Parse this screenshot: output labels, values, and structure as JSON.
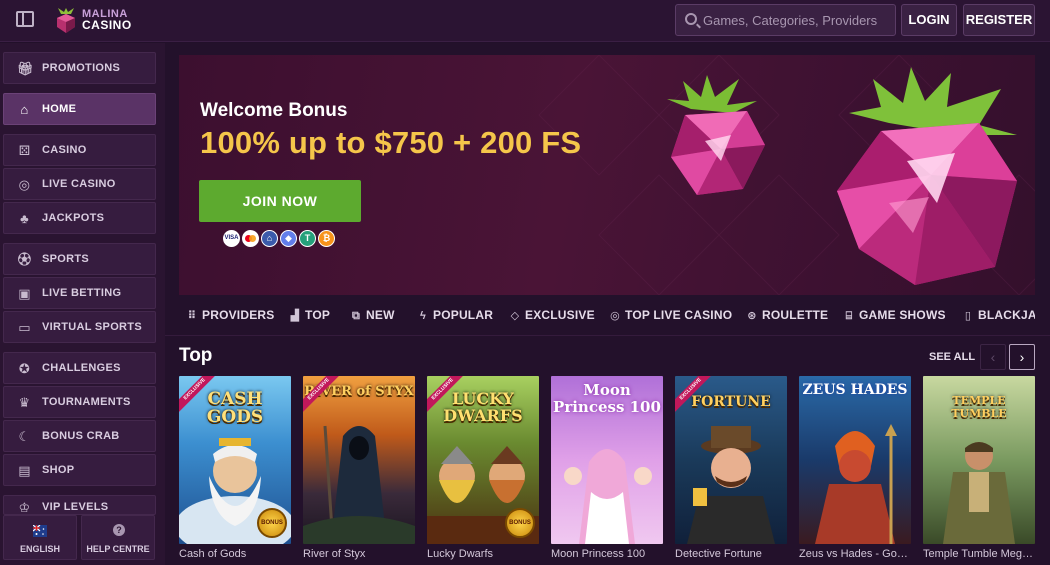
{
  "header": {
    "logo_line1": "MALINA",
    "logo_line2": "CASINO",
    "search_placeholder": "Games, Categories, Providers",
    "login_label": "LOGIN",
    "register_label": "REGISTER"
  },
  "sidebar": {
    "items": [
      {
        "label": "PROMOTIONS",
        "icon": "gift-icon"
      },
      {
        "label": "HOME",
        "icon": "home-icon"
      },
      {
        "label": "CASINO",
        "icon": "dice-icon"
      },
      {
        "label": "LIVE CASINO",
        "icon": "chip-icon"
      },
      {
        "label": "JACKPOTS",
        "icon": "money-bag-icon"
      },
      {
        "label": "SPORTS",
        "icon": "football-icon"
      },
      {
        "label": "LIVE BETTING",
        "icon": "live-icon"
      },
      {
        "label": "VIRTUAL SPORTS",
        "icon": "monitor-icon"
      },
      {
        "label": "CHALLENGES",
        "icon": "medal-icon"
      },
      {
        "label": "TOURNAMENTS",
        "icon": "trophy-icon"
      },
      {
        "label": "BONUS CRAB",
        "icon": "crab-claw-icon"
      },
      {
        "label": "SHOP",
        "icon": "shop-icon"
      },
      {
        "label": "VIP LEVELS",
        "icon": "crown-icon"
      }
    ],
    "language_label": "ENGLISH",
    "help_label": "HELP CENTRE"
  },
  "banner": {
    "subtitle": "Welcome Bonus",
    "title": "100% up to $750 + 200 FS",
    "cta_label": "JOIN NOW",
    "payments": [
      "VISA",
      "MC",
      "BANK",
      "ETH",
      "USDT",
      "BTC"
    ]
  },
  "categories": [
    {
      "label": "PROVIDERS",
      "icon": "grid-icon"
    },
    {
      "label": "TOP",
      "icon": "podium-icon"
    },
    {
      "label": "NEW",
      "icon": "new-icon"
    },
    {
      "label": "POPULAR",
      "icon": "lightning-icon"
    },
    {
      "label": "EXCLUSIVE",
      "icon": "diamond-icon"
    },
    {
      "label": "TOP LIVE CASINO",
      "icon": "chip-icon"
    },
    {
      "label": "ROULETTE",
      "icon": "roulette-icon"
    },
    {
      "label": "GAME SHOWS",
      "icon": "tv-icon"
    },
    {
      "label": "BLACKJACK",
      "icon": "cards-icon"
    }
  ],
  "top_section": {
    "title": "Top",
    "see_all_label": "SEE ALL",
    "games": [
      {
        "name": "Cash of Gods",
        "logo": "CASH GODS",
        "exclusive": true,
        "bonus": true
      },
      {
        "name": "River of Styx",
        "logo": "RIVER of STYX",
        "exclusive": true,
        "bonus": false
      },
      {
        "name": "Lucky Dwarfs",
        "logo": "LUCKY DWARFS",
        "exclusive": true,
        "bonus": true
      },
      {
        "name": "Moon Princess 100",
        "logo": "Moon Princess 100",
        "exclusive": false,
        "bonus": false
      },
      {
        "name": "Detective Fortune",
        "logo": "FORTUNE",
        "exclusive": true,
        "bonus": false
      },
      {
        "name": "Zeus vs Hades - Gods of War",
        "logo": "ZEUS HADES",
        "exclusive": false,
        "bonus": false
      },
      {
        "name": "Temple Tumble Megaways",
        "logo": "TEMPLE TUMBLE",
        "exclusive": false,
        "bonus": false
      }
    ],
    "exclusive_badge": "EXCLUSIVE",
    "bonus_badge": "BONUS"
  },
  "colors": {
    "background": "#22102a",
    "sidebar": "#2a1431",
    "active_nav": "#5a3366",
    "accent_gold": "#f5c64a",
    "cta_green": "#5daa2f"
  }
}
